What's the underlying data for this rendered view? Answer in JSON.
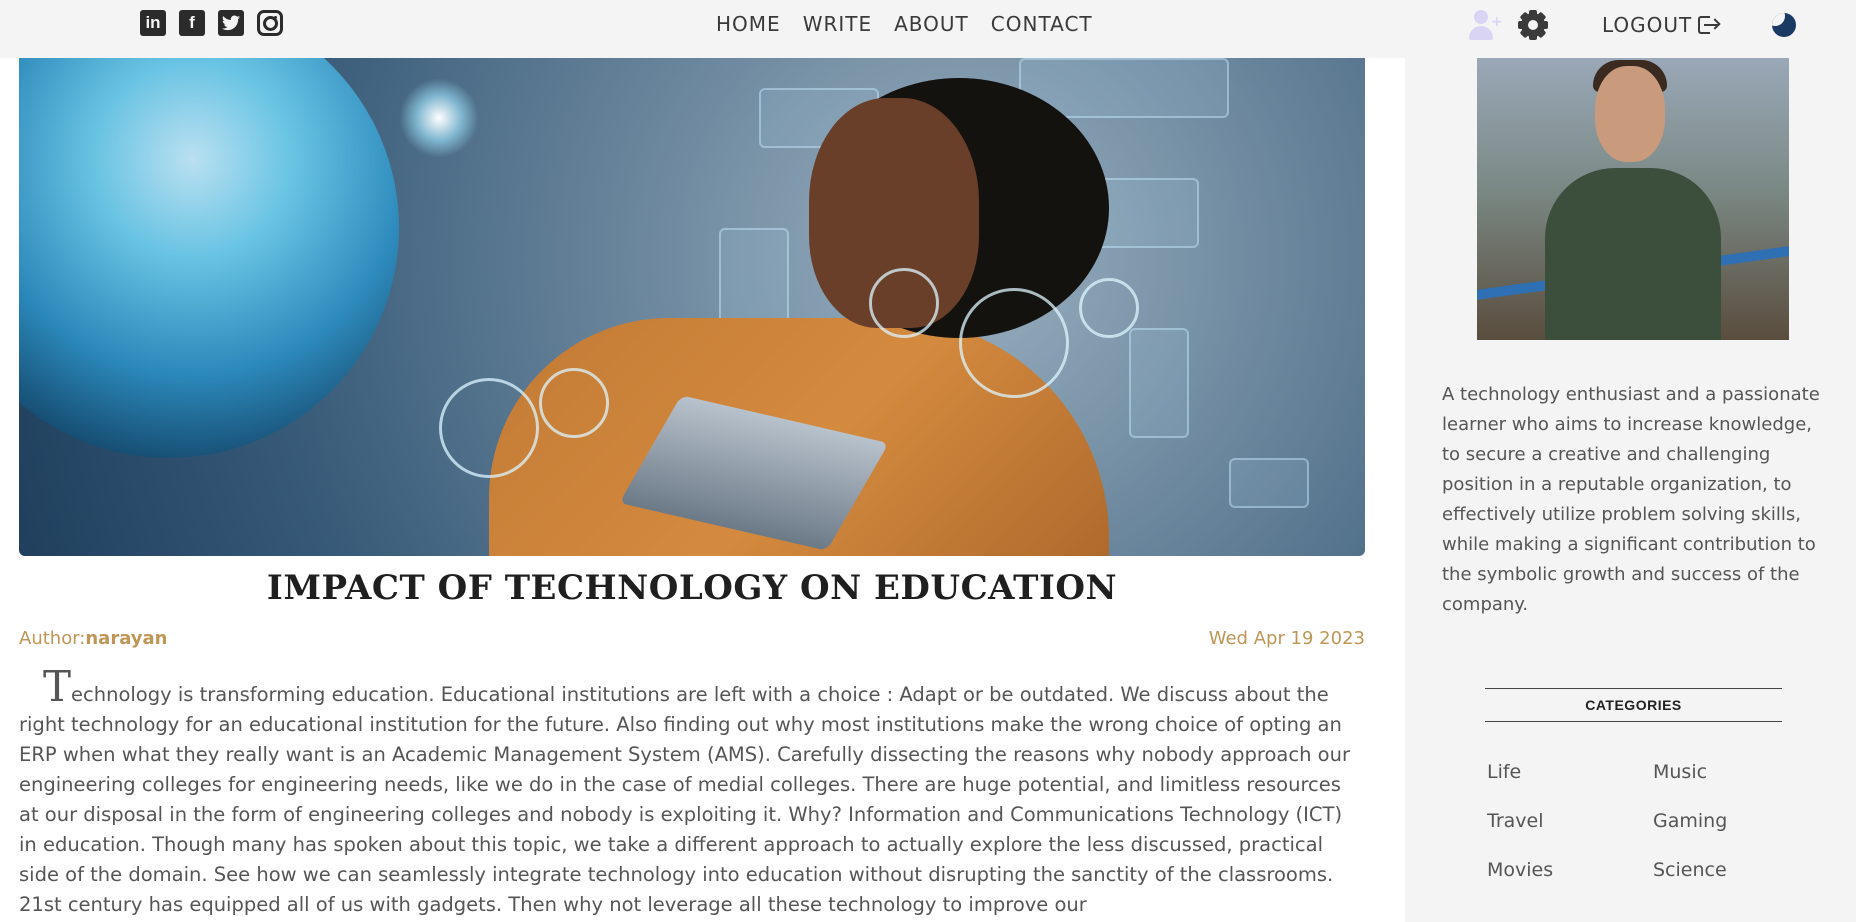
{
  "social": {
    "linkedin": "in",
    "facebook": "f"
  },
  "nav": {
    "home": "HOME",
    "write": "WRITE",
    "about": "ABOUT",
    "contact": "CONTACT",
    "logout": "LOGOUT"
  },
  "post": {
    "title": "IMPACT OF TECHNOLOGY ON EDUCATION",
    "author_label": "Author:",
    "author_name": "narayan",
    "date": "Wed Apr 19 2023",
    "dropcap": "T",
    "body": "echnology is transforming education. Educational institutions are left with a choice : Adapt or be outdated. We discuss about the right technology for an educational institution for the future. Also finding out why most institutions make the wrong choice of opting an ERP when what they really want is an Academic Management System (AMS). Carefully dissecting the reasons why nobody approach our engineering colleges for engineering needs, like we do in the case of medial colleges. There are huge potential, and limitless resources at our disposal in the form of engineering colleges and nobody is exploiting it. Why? Information and Communications Technology (ICT) in education. Though many has spoken about this topic, we take a different approach to actually explore the less discussed, practical side of the domain. See how we can seamlessly integrate technology into education without disrupting the sanctity of the classrooms. 21st century has equipped all of us with gadgets. Then why not leverage all these technology to improve our"
  },
  "sidebar": {
    "about": "A technology enthusiast and a passionate learner who aims to increase knowledge, to secure a creative and challenging position in a reputable organization, to effectively utilize problem solving skills, while making a significant contribution to the symbolic growth and success of the company.",
    "categories_title": "CATEGORIES",
    "categories": [
      "Life",
      "Music",
      "Travel",
      "Gaming",
      "Movies",
      "Science"
    ]
  },
  "colors": {
    "meta": "#be9656",
    "topbar": "#f4f4f4",
    "theme_toggle": "#1b3a63"
  },
  "icons": [
    "linkedin-icon",
    "facebook-icon",
    "twitter-icon",
    "instagram-icon",
    "add-user-icon",
    "gear-icon",
    "logout-icon",
    "moon-icon"
  ]
}
